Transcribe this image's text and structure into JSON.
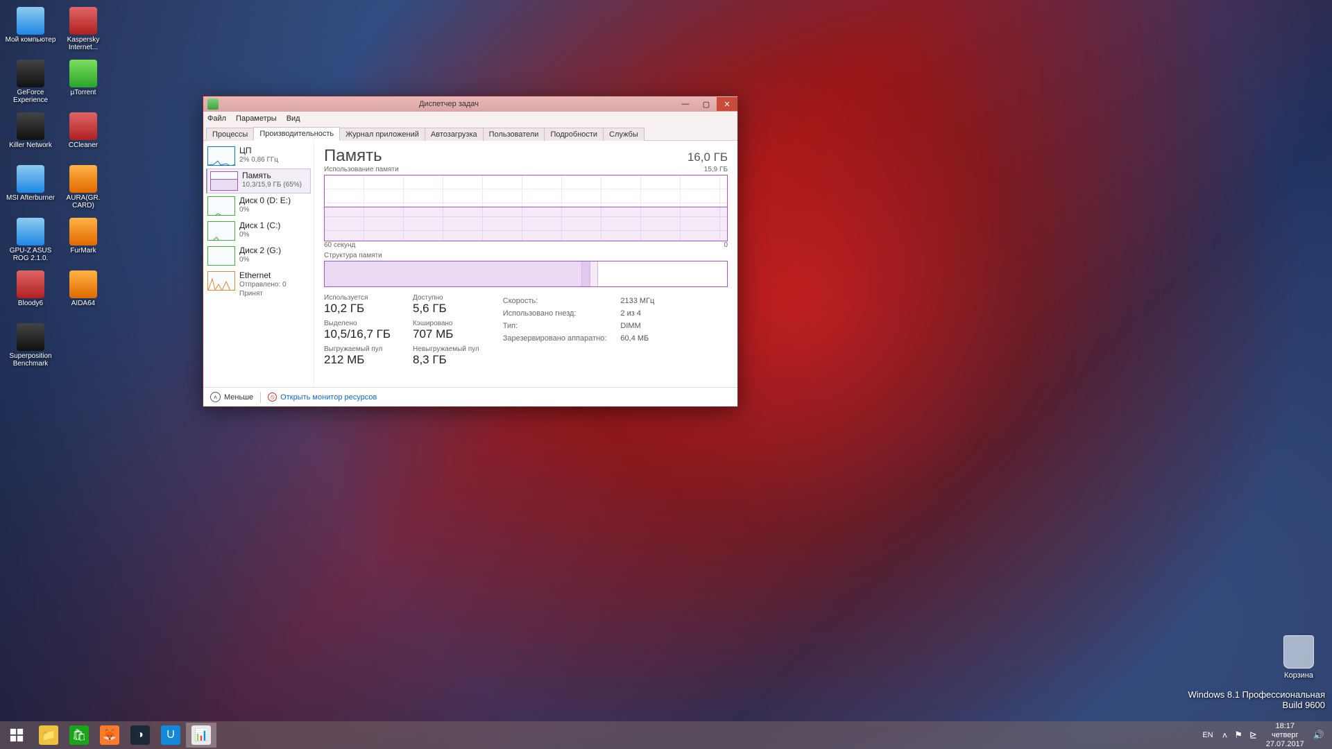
{
  "desktop": {
    "icons": [
      [
        {
          "name": "Мой компьютер",
          "style": "win"
        },
        {
          "name": "Kaspersky Internet...",
          "style": "red"
        }
      ],
      [
        {
          "name": "GeForce Experience",
          "style": "dark"
        },
        {
          "name": "µTorrent",
          "style": "green"
        }
      ],
      [
        {
          "name": "Killer Network",
          "style": "dark"
        },
        {
          "name": "CCleaner",
          "style": "red"
        }
      ],
      [
        {
          "name": "MSI Afterburner",
          "style": "win"
        },
        {
          "name": "AURA(GR. CARD)",
          "style": "orange"
        }
      ],
      [
        {
          "name": "GPU-Z ASUS ROG 2.1.0.",
          "style": "win"
        },
        {
          "name": "FurMark",
          "style": "orange"
        }
      ],
      [
        {
          "name": "Bloody6",
          "style": "red"
        },
        {
          "name": "AIDA64",
          "style": "orange"
        }
      ],
      [
        {
          "name": "Superposition Benchmark",
          "style": "dark"
        }
      ]
    ],
    "recycle": "Корзина",
    "watermark_line1": "Windows 8.1 Профессиональная",
    "watermark_line2": "Build 9600"
  },
  "taskbar": {
    "lang": "EN",
    "time": "18:17",
    "day": "четверг",
    "date": "27.07.2017"
  },
  "tm": {
    "title": "Диспетчер задач",
    "menu": [
      "Файл",
      "Параметры",
      "Вид"
    ],
    "tabs": [
      "Процессы",
      "Производительность",
      "Журнал приложений",
      "Автозагрузка",
      "Пользователи",
      "Подробности",
      "Службы"
    ],
    "active_tab": 1,
    "sidebar": {
      "cpu": {
        "name": "ЦП",
        "sub": "2% 0,86 ГГц"
      },
      "memory": {
        "name": "Память",
        "sub": "10,3/15,9 ГБ (65%)"
      },
      "disk0": {
        "name": "Диск 0 (D: E:)",
        "sub": "0%"
      },
      "disk1": {
        "name": "Диск 1 (C:)",
        "sub": "0%"
      },
      "disk2": {
        "name": "Диск 2 (G:)",
        "sub": "0%"
      },
      "ethernet": {
        "name": "Ethernet",
        "sub": "Отправлено: 0 Принят"
      }
    },
    "main": {
      "heading": "Память",
      "capacity": "16,0 ГБ",
      "usage_label": "Использование памяти",
      "usage_max": "15,9 ГБ",
      "x_left": "60 секунд",
      "x_right": "0",
      "composition_label": "Структура памяти",
      "stats": {
        "in_use_lbl": "Используется",
        "in_use": "10,2 ГБ",
        "avail_lbl": "Доступно",
        "avail": "5,6 ГБ",
        "committed_lbl": "Выделено",
        "committed": "10,5/16,7 ГБ",
        "cached_lbl": "Кэшировано",
        "cached": "707 МБ",
        "paged_lbl": "Выгружаемый пул",
        "paged": "212 МБ",
        "nonpaged_lbl": "Невыгружаемый пул",
        "nonpaged": "8,3 ГБ"
      },
      "facts": {
        "speed_lbl": "Скорость:",
        "speed": "2133 МГц",
        "slots_lbl": "Использовано гнезд:",
        "slots": "2 из 4",
        "form_lbl": "Тип:",
        "form": "DIMM",
        "reserved_lbl": "Зарезервировано аппаратно:",
        "reserved": "60,4 МБ"
      }
    },
    "footer": {
      "less": "Меньше",
      "resmon": "Открыть монитор ресурсов"
    }
  },
  "chart_data": {
    "type": "line",
    "title": "Использование памяти",
    "ylabel": "ГБ",
    "ylim": [
      0,
      15.9
    ],
    "x": [
      "60 секунд",
      "0"
    ],
    "series": [
      {
        "name": "Память",
        "values": [
          10.3,
          10.3,
          10.2,
          10.3,
          10.2,
          10.2,
          10.2,
          10.2,
          10.2,
          10.2
        ]
      }
    ]
  }
}
